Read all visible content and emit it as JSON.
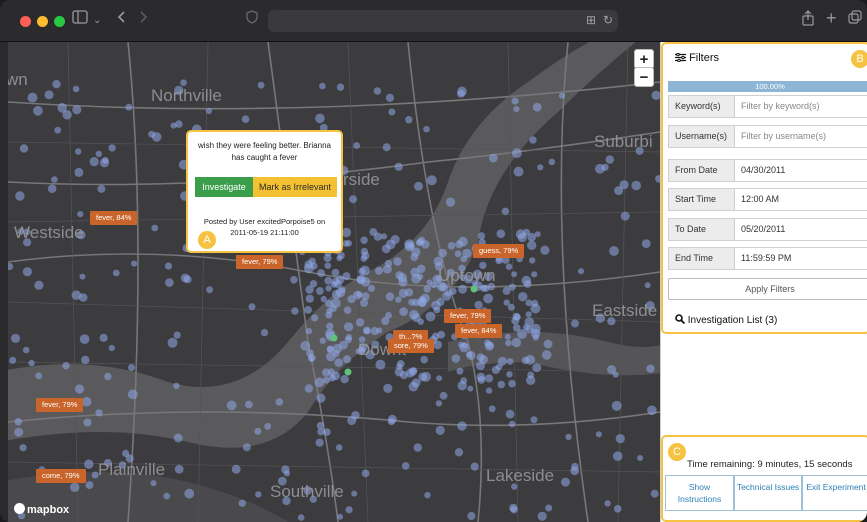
{
  "browser": {
    "icons": {
      "sidebar": "sidebar-icon",
      "back": "chevron-left-icon",
      "forward": "chevron-right-icon",
      "shield": "shield-icon",
      "translate": "translate-icon",
      "reload": "reload-icon",
      "share": "share-icon",
      "new_tab": "plus-icon",
      "tabs": "tab-overview-icon"
    }
  },
  "map": {
    "places": [
      "wn",
      "Northville",
      "Suburbi",
      "rside",
      "Westside",
      "Uptown",
      "Eastside",
      "Downt",
      "Plainville",
      "Southville",
      "Lakeside"
    ],
    "zoom_in": "+",
    "zoom_out": "−",
    "attribution": "mapbox",
    "tags": [
      "fever, 84%",
      "fever, 79%",
      "guess, 79%",
      "fever, 79%",
      "fever, 84%",
      "th...?%",
      "sore, 79%",
      "fever, 79%",
      "come, 79%"
    ],
    "popup": {
      "message": "wish they were feeling better. Brianna has caught a fever",
      "investigate_label": "Investigate",
      "irrelevant_label": "Mark as Irrelevant",
      "posted": "Posted by User excitedPorpoise5 on 2011-05-19 21:11:00",
      "badge": "A"
    }
  },
  "panel": {
    "filters_title": "Filters",
    "badge_b": "B",
    "progress_label": "100.00%",
    "progress_fraction": 1.0,
    "rows": [
      {
        "label": "Keyword(s)",
        "value": "Filter by keyword(s)"
      },
      {
        "label": "Username(s)",
        "value": "Filter by username(s)"
      },
      {
        "label": "From Date",
        "value": "04/30/2011"
      },
      {
        "label": "Start Time",
        "value": "12:00 AM"
      },
      {
        "label": "To Date",
        "value": "05/20/2011"
      },
      {
        "label": "End Time",
        "value": "11:59:59 PM"
      }
    ],
    "apply_label": "Apply Filters",
    "investigation_list": "Investigation List (3)",
    "badge_c": "C",
    "time_remaining": "Time remaining: 9 minutes, 15 seconds",
    "buttons": [
      "Show Instructions",
      "Technical Issues",
      "Exit Experiment"
    ]
  },
  "colors": {
    "accent": "#f5c242",
    "investigate": "#3a9e4a",
    "irrelevant": "#f3c131",
    "tag": "#c9652a",
    "tweet_dot": "#8fa8e8"
  }
}
